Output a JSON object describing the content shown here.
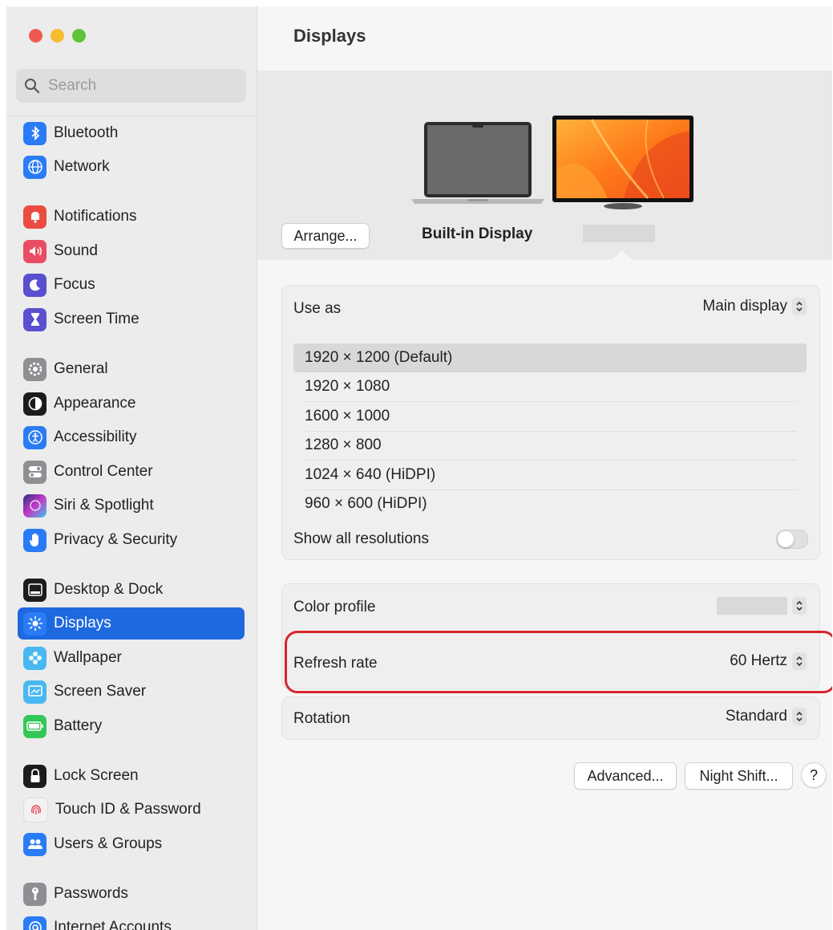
{
  "colors": {
    "close": "#ee5a52",
    "minimize": "#f5bd2f",
    "zoom": "#5fc338",
    "selection": "#1f69e0",
    "highlight": "#d7262c"
  },
  "search": {
    "placeholder": "Search"
  },
  "sidebar": {
    "items": [
      {
        "label": "Bluetooth",
        "icon": "bluetooth-icon",
        "color": "#2a7cf6"
      },
      {
        "label": "Network",
        "icon": "globe-icon",
        "color": "#2a7cf6"
      },
      {
        "label": "Notifications",
        "icon": "bell-icon",
        "color": "#ea4c42"
      },
      {
        "label": "Sound",
        "icon": "speaker-icon",
        "color": "#ea4c63"
      },
      {
        "label": "Focus",
        "icon": "moon-icon",
        "color": "#5a4fcf"
      },
      {
        "label": "Screen Time",
        "icon": "hourglass-icon",
        "color": "#5a4fcf"
      },
      {
        "label": "General",
        "icon": "gear-icon",
        "color": "#8e8e93"
      },
      {
        "label": "Appearance",
        "icon": "appearance-icon",
        "color": "#1c1c1e"
      },
      {
        "label": "Accessibility",
        "icon": "accessibility-icon",
        "color": "#2a7cf6"
      },
      {
        "label": "Control Center",
        "icon": "toggles-icon",
        "color": "#8e8e93"
      },
      {
        "label": "Siri & Spotlight",
        "icon": "siri-icon",
        "color": "#6a3ec9"
      },
      {
        "label": "Privacy & Security",
        "icon": "hand-icon",
        "color": "#2a7cf6"
      },
      {
        "label": "Desktop & Dock",
        "icon": "dock-icon",
        "color": "#1c1c1e"
      },
      {
        "label": "Displays",
        "icon": "sun-icon",
        "color": "#2a7cf6"
      },
      {
        "label": "Wallpaper",
        "icon": "flower-icon",
        "color": "#49b8f0"
      },
      {
        "label": "Screen Saver",
        "icon": "screensaver-icon",
        "color": "#49b8f0"
      },
      {
        "label": "Battery",
        "icon": "battery-icon",
        "color": "#34c759"
      },
      {
        "label": "Lock Screen",
        "icon": "lock-icon",
        "color": "#1c1c1e"
      },
      {
        "label": "Touch ID & Password",
        "icon": "fingerprint-icon",
        "color": "#f2f2f2"
      },
      {
        "label": "Users & Groups",
        "icon": "users-icon",
        "color": "#2a7cf6"
      },
      {
        "label": "Passwords",
        "icon": "key-icon",
        "color": "#8e8e93"
      },
      {
        "label": "Internet Accounts",
        "icon": "at-icon",
        "color": "#2a7cf6"
      }
    ],
    "selected": "Displays"
  },
  "main": {
    "title": "Displays",
    "arrange_label": "Arrange...",
    "builtin_display_label": "Built-in Display",
    "use_as": {
      "label": "Use as",
      "value": "Main display"
    },
    "resolutions": [
      "1920 × 1200 (Default)",
      "1920 × 1080",
      "1600 × 1000",
      "1280 × 800",
      "1024 × 640 (HiDPI)",
      "960 × 600 (HiDPI)"
    ],
    "selected_resolution": "1920 × 1200 (Default)",
    "show_all_resolutions": {
      "label": "Show all resolutions",
      "on": false
    },
    "color_profile": {
      "label": "Color profile"
    },
    "refresh_rate": {
      "label": "Refresh rate",
      "value": "60 Hertz"
    },
    "rotation": {
      "label": "Rotation",
      "value": "Standard"
    },
    "buttons": {
      "advanced": "Advanced...",
      "night_shift": "Night Shift...",
      "help": "?"
    }
  }
}
